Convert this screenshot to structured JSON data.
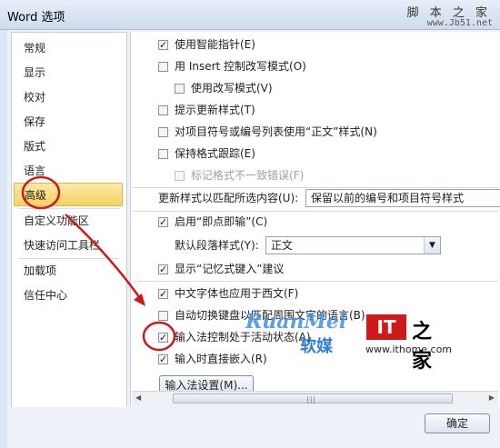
{
  "window": {
    "title": "Word 选项"
  },
  "watermark": {
    "site_name": "脚 本 之 家",
    "site_url": "www.Jb51.net"
  },
  "sidebar": {
    "items": [
      {
        "label": "常规"
      },
      {
        "label": "显示"
      },
      {
        "label": "校对"
      },
      {
        "label": "保存"
      },
      {
        "label": "版式"
      },
      {
        "label": "语言"
      },
      {
        "label": "高级",
        "selected": true
      },
      {
        "label": "自定义功能区"
      },
      {
        "label": "快速访问工具栏"
      },
      {
        "label": "加载项"
      },
      {
        "label": "信任中心"
      }
    ]
  },
  "options": {
    "smart_cursor": {
      "label": "使用智能指针(E)",
      "checked": true
    },
    "insert_key": {
      "label": "用 Insert 控制改写模式(O)",
      "checked": false
    },
    "overtype": {
      "label": "使用改写模式(V)",
      "checked": false
    },
    "prompt_update_styles": {
      "label": "提示更新样式(T)",
      "checked": false
    },
    "normal_style_lists": {
      "label": "对项目符号或编号列表使用“正文”样式(N)",
      "checked": false
    },
    "track_formatting": {
      "label": "保持格式跟踪(E)",
      "checked": false
    },
    "mark_inconsistencies": {
      "label": "标记格式不一致错误(F)",
      "checked": false
    },
    "update_style_label": "更新样式以匹配所选内容(U):",
    "update_style_value": "保留以前的编号和项目符号样式",
    "click_and_type": {
      "label": "启用“即点即输”(C)",
      "checked": true
    },
    "default_para_label": "默认段落样式(Y):",
    "default_para_value": "正文",
    "autocomplete": {
      "label": "显示“记忆式键入”建议",
      "checked": true
    },
    "chinese_font_western": {
      "label": "中文字体也应用于西文(F)",
      "checked": true
    },
    "auto_keyboard": {
      "label": "自动切换键盘以匹配周围文字的语言(B)",
      "checked": false
    },
    "ime_control": {
      "label": "输入法控制处于活动状态(A)",
      "checked": true
    },
    "direct_input": {
      "label": "输入时直接嵌入(R)",
      "checked": true
    },
    "ime_settings_button": "输入法设置(M)..."
  },
  "footer": {
    "ok_button": "确定"
  },
  "logos": {
    "ruanmei_latin": "RuanMei",
    "ruanmei_cn": "软媒",
    "ithome_it": "IT",
    "ithome_cn": "之家",
    "ithome_url": "www.ithome.com"
  },
  "colors": {
    "selection": "#f6d162",
    "annotation": "#cc1a1a",
    "ruanmei": "#3f8fe0",
    "ithome": "#cf1a1a"
  }
}
